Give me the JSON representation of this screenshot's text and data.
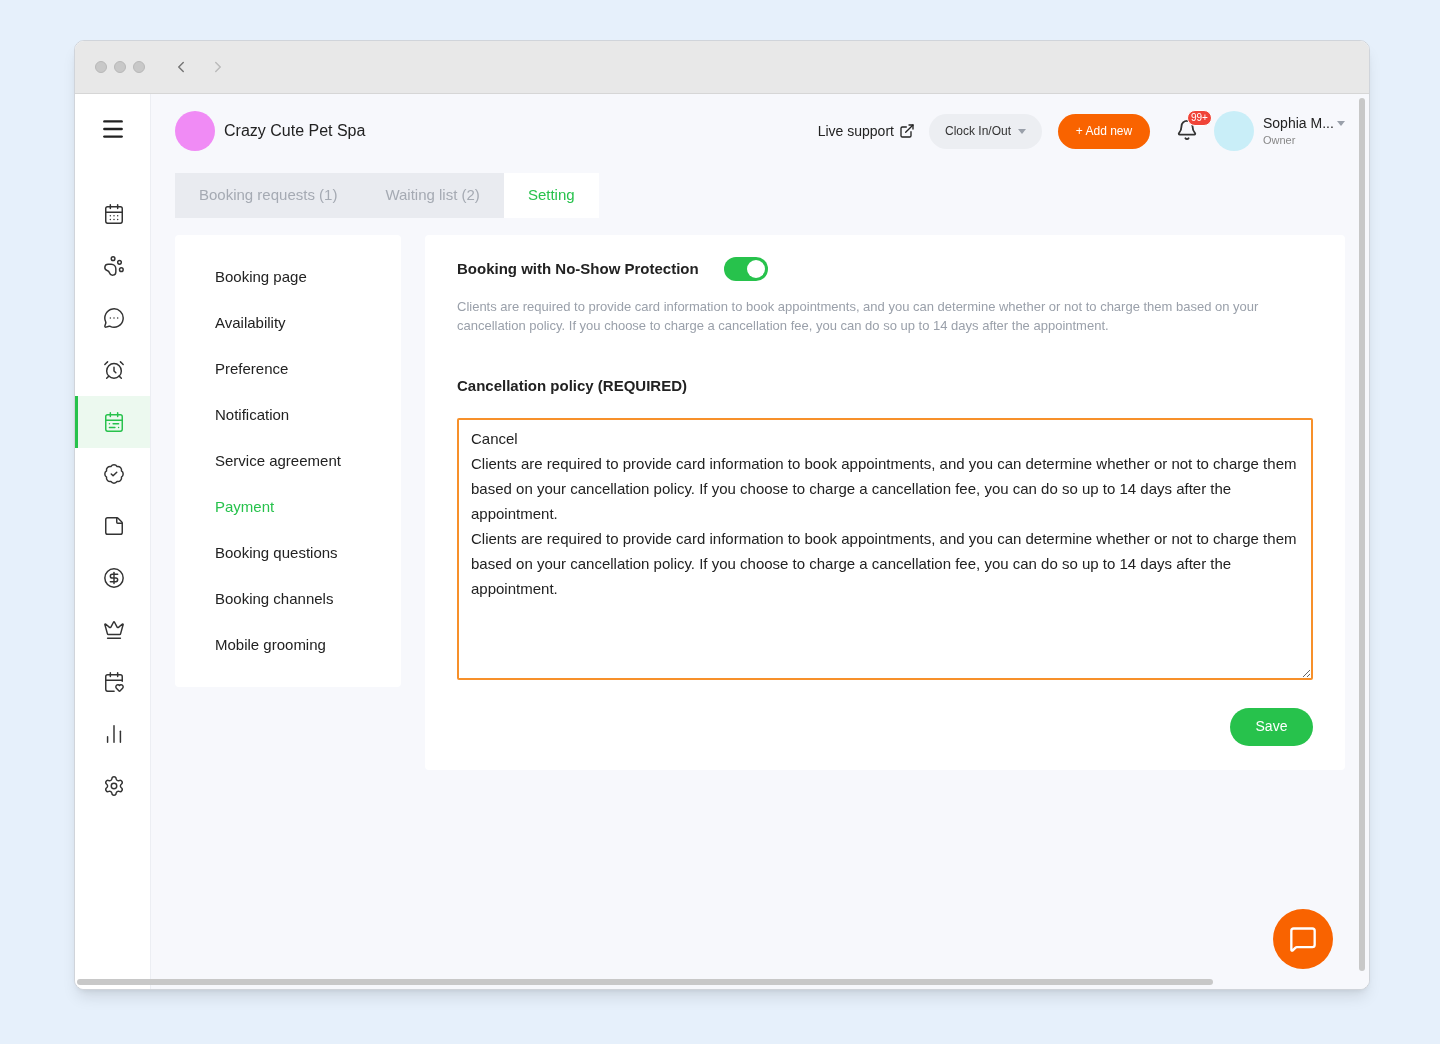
{
  "nav_items": [
    {
      "selected": false
    },
    {
      "selected": false
    },
    {
      "selected": false
    },
    {
      "selected": false
    },
    {
      "selected": true
    },
    {
      "selected": false
    },
    {
      "selected": false
    },
    {
      "selected": false
    },
    {
      "selected": false
    },
    {
      "selected": false
    },
    {
      "selected": false
    },
    {
      "selected": false
    }
  ],
  "business": {
    "name": "Crazy Cute Pet Spa"
  },
  "header": {
    "live_support": "Live support",
    "clock": "Clock In/Out",
    "add_new": "+ Add new",
    "notification_count": "99+",
    "user_name": "Sophia M...",
    "user_role": "Owner"
  },
  "tabs": [
    {
      "label": "Booking requests (1)",
      "selected": false
    },
    {
      "label": "Waiting list (2)",
      "selected": false
    },
    {
      "label": "Setting",
      "selected": true
    }
  ],
  "settings_menu": [
    {
      "label": "Booking page",
      "selected": false
    },
    {
      "label": "Availability",
      "selected": false
    },
    {
      "label": "Preference",
      "selected": false
    },
    {
      "label": "Notification",
      "selected": false
    },
    {
      "label": "Service agreement",
      "selected": false
    },
    {
      "label": "Payment",
      "selected": true
    },
    {
      "label": "Booking questions",
      "selected": false
    },
    {
      "label": "Booking channels",
      "selected": false
    },
    {
      "label": "Mobile grooming",
      "selected": false
    }
  ],
  "protection": {
    "title": "Booking with No-Show Protection",
    "on": true,
    "description": "Clients are required to provide card information to book appointments, and you can determine whether or not to charge them based on your cancellation policy. If you choose to charge a cancellation fee, you can do so up to 14 days after the appointment."
  },
  "policy": {
    "label": "Cancellation policy (REQUIRED)",
    "value": "Cancel\nClients are required to provide card information to book appointments, and you can determine whether or not to charge them based on your cancellation policy. If you choose to charge a cancellation fee, you can do so up to 14 days after the appointment.\nClients are required to provide card information to book appointments, and you can determine whether or not to charge them based on your cancellation policy. If you choose to charge a cancellation fee, you can do so up to 14 days after the appointment."
  },
  "save": "Save"
}
